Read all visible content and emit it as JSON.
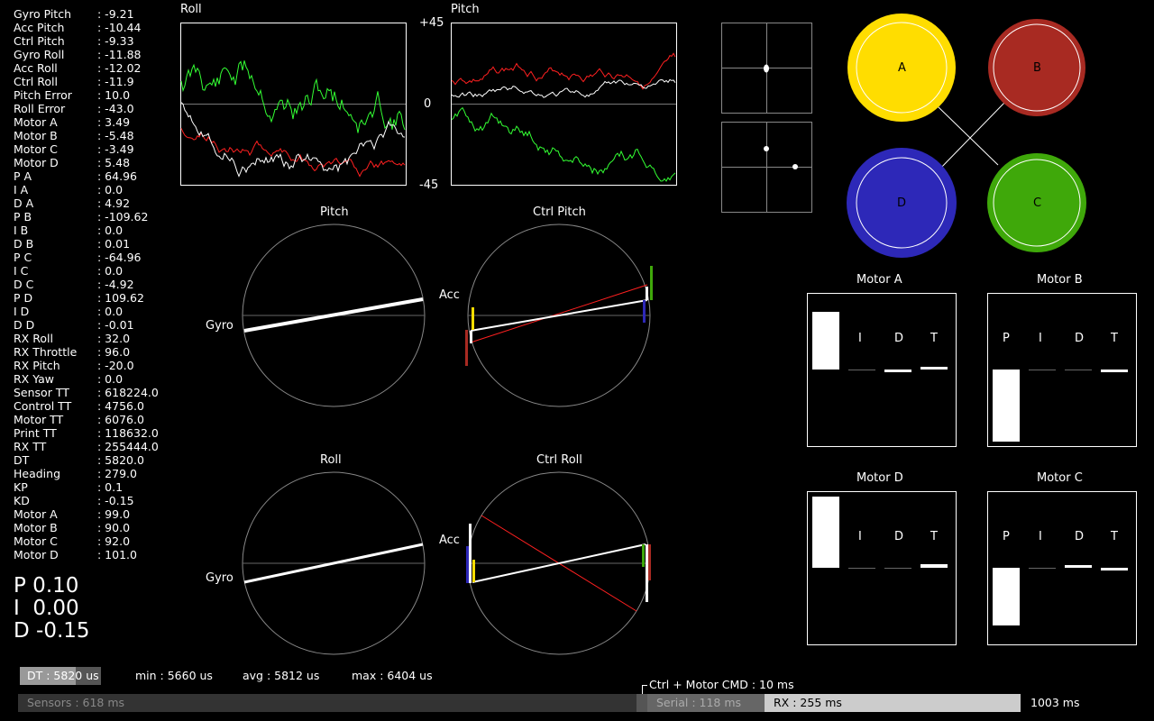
{
  "telemetry": [
    {
      "key": "Gyro Pitch",
      "value": "-9.21"
    },
    {
      "key": "Acc Pitch",
      "value": "-10.44"
    },
    {
      "key": "Ctrl Pitch",
      "value": "-9.33"
    },
    {
      "key": "Gyro Roll",
      "value": "-11.88"
    },
    {
      "key": "Acc Roll",
      "value": "-12.02"
    },
    {
      "key": "Ctrl Roll",
      "value": "-11.9"
    },
    {
      "key": "Pitch Error",
      "value": "10.0"
    },
    {
      "key": "Roll Error",
      "value": "-43.0"
    },
    {
      "key": "Motor A",
      "value": "3.49"
    },
    {
      "key": "Motor B",
      "value": "-5.48"
    },
    {
      "key": "Motor C",
      "value": "-3.49"
    },
    {
      "key": "Motor D",
      "value": "5.48"
    },
    {
      "key": "P A",
      "value": "64.96"
    },
    {
      "key": "I A",
      "value": "0.0"
    },
    {
      "key": "D A",
      "value": "4.92"
    },
    {
      "key": "P B",
      "value": "-109.62"
    },
    {
      "key": "I B",
      "value": "0.0"
    },
    {
      "key": "D B",
      "value": "0.01"
    },
    {
      "key": "P C",
      "value": "-64.96"
    },
    {
      "key": "I C",
      "value": "0.0"
    },
    {
      "key": "D C",
      "value": "-4.92"
    },
    {
      "key": "P D",
      "value": "109.62"
    },
    {
      "key": "I D",
      "value": "0.0"
    },
    {
      "key": "D D",
      "value": "-0.01"
    },
    {
      "key": "RX Roll",
      "value": "32.0"
    },
    {
      "key": "RX Throttle",
      "value": "96.0"
    },
    {
      "key": "RX Pitch",
      "value": "-20.0"
    },
    {
      "key": "RX Yaw",
      "value": "0.0"
    },
    {
      "key": "Sensor TT",
      "value": "618224.0"
    },
    {
      "key": "Control TT",
      "value": "4756.0"
    },
    {
      "key": "Motor TT",
      "value": "6076.0"
    },
    {
      "key": "Print TT",
      "value": "118632.0"
    },
    {
      "key": "RX TT",
      "value": "255444.0"
    },
    {
      "key": "DT",
      "value": "5820.0"
    },
    {
      "key": "Heading",
      "value": "279.0"
    },
    {
      "key": "KP",
      "value": "0.1"
    },
    {
      "key": "KD",
      "value": "-0.15"
    },
    {
      "key": "Motor A",
      "value": "99.0"
    },
    {
      "key": "Motor B",
      "value": "90.0"
    },
    {
      "key": "Motor C",
      "value": "92.0"
    },
    {
      "key": "Motor D",
      "value": "101.0"
    }
  ],
  "separator": ":",
  "pid_gains": {
    "p": "P 0.10",
    "i": "I  0.00",
    "d": "D -0.15"
  },
  "graphs": {
    "roll_title": "Roll",
    "pitch_title": "Pitch",
    "y_max": "+45",
    "y_zero": "0",
    "y_min": "-45",
    "series_colors": {
      "gyro": "#33ff33",
      "acc": "#ff2020",
      "ctrl": "#ffffff"
    }
  },
  "dials": {
    "pitch": {
      "title": "Pitch",
      "gyro_label": "Gyro"
    },
    "ctrl_pitch": {
      "title": "Ctrl Pitch",
      "acc_label": "Acc"
    },
    "roll": {
      "title": "Roll",
      "gyro_label": "Gyro"
    },
    "ctrl_roll": {
      "title": "Ctrl Roll",
      "acc_label": "Acc"
    }
  },
  "motors_diagram": {
    "a": {
      "label": "A",
      "color": "#ffdd00"
    },
    "b": {
      "label": "B",
      "color": "#a82a22"
    },
    "c": {
      "label": "C",
      "color": "#3fa80a"
    },
    "d": {
      "label": "D",
      "color": "#2d28b8"
    }
  },
  "motor_panels": {
    "a": {
      "title": "Motor A",
      "labels": {
        "i": "I",
        "d": "D",
        "t": "T"
      },
      "p_value": 64.96,
      "d_value": 4.92
    },
    "b": {
      "title": "Motor B",
      "labels": {
        "p": "P",
        "i": "I",
        "d": "D",
        "t": "T"
      },
      "p_value": -109.62,
      "d_value": 0.01
    },
    "d": {
      "title": "Motor D",
      "labels": {
        "i": "I",
        "d": "D",
        "t": "T"
      },
      "p_value": 109.62,
      "d_value": -0.01
    },
    "c": {
      "title": "Motor C",
      "labels": {
        "p": "P",
        "i": "I",
        "d": "D",
        "t": "T"
      },
      "p_value": -64.96,
      "d_value": -4.92
    }
  },
  "timing": {
    "dt": "DT : 5820 us",
    "min": "min : 5660 us",
    "avg": "avg : 5812 us",
    "max": "max : 6404 us",
    "ctrl_motor": "Ctrl + Motor CMD : 10 ms",
    "sensors": "Sensors : 618 ms",
    "serial": "Serial : 118 ms",
    "rx": "RX : 255 ms",
    "total": "1003 ms"
  }
}
